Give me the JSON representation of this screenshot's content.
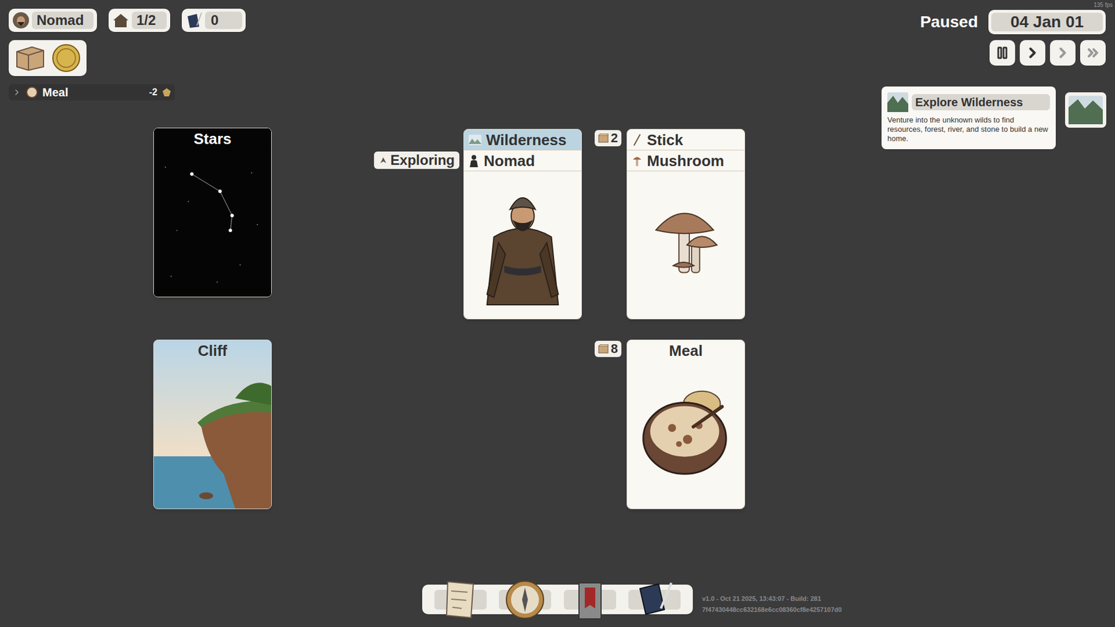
{
  "hud": {
    "player": "Nomad",
    "housing": "1/2",
    "ideas": "0",
    "fps": "135 fps"
  },
  "needs": [
    {
      "label": "Meal",
      "value": "-2",
      "expanded": false
    }
  ],
  "clock": {
    "status": "Paused",
    "date": "04 Jan 01"
  },
  "speed_buttons": [
    {
      "kind": "pause"
    },
    {
      "kind": "play"
    },
    {
      "kind": "fast"
    },
    {
      "kind": "faster"
    }
  ],
  "tooltip": {
    "title": "Explore Wilderness",
    "description": "Venture into the unknown wilds to find resources, forest, river, and stone to build a new home."
  },
  "stacks": [
    {
      "cards": [
        {
          "title": "Stars",
          "kind": "stars"
        }
      ]
    },
    {
      "cards": [
        {
          "title": "Cliff",
          "kind": "cliff"
        }
      ]
    },
    {
      "status": "Exploring",
      "cards": [
        {
          "title": "Wilderness",
          "kind": "wilderness"
        },
        {
          "title": "Nomad",
          "kind": "person"
        }
      ]
    },
    {
      "count": "2",
      "cards": [
        {
          "title": "Stick",
          "kind": "stick"
        },
        {
          "title": "Mushroom",
          "kind": "mushroom"
        }
      ]
    },
    {
      "count": "8",
      "cards": [
        {
          "title": "Meal",
          "kind": "meal"
        }
      ]
    }
  ],
  "toolbar": [
    {
      "kind": "map"
    },
    {
      "kind": "compass"
    },
    {
      "kind": "castle"
    },
    {
      "kind": "book"
    }
  ],
  "version": [
    "v1.0 - Oct 21 2025, 13:43:07 - Build: 281",
    "7f47430448cc632168e6cc08360cf8e4257107d0"
  ]
}
